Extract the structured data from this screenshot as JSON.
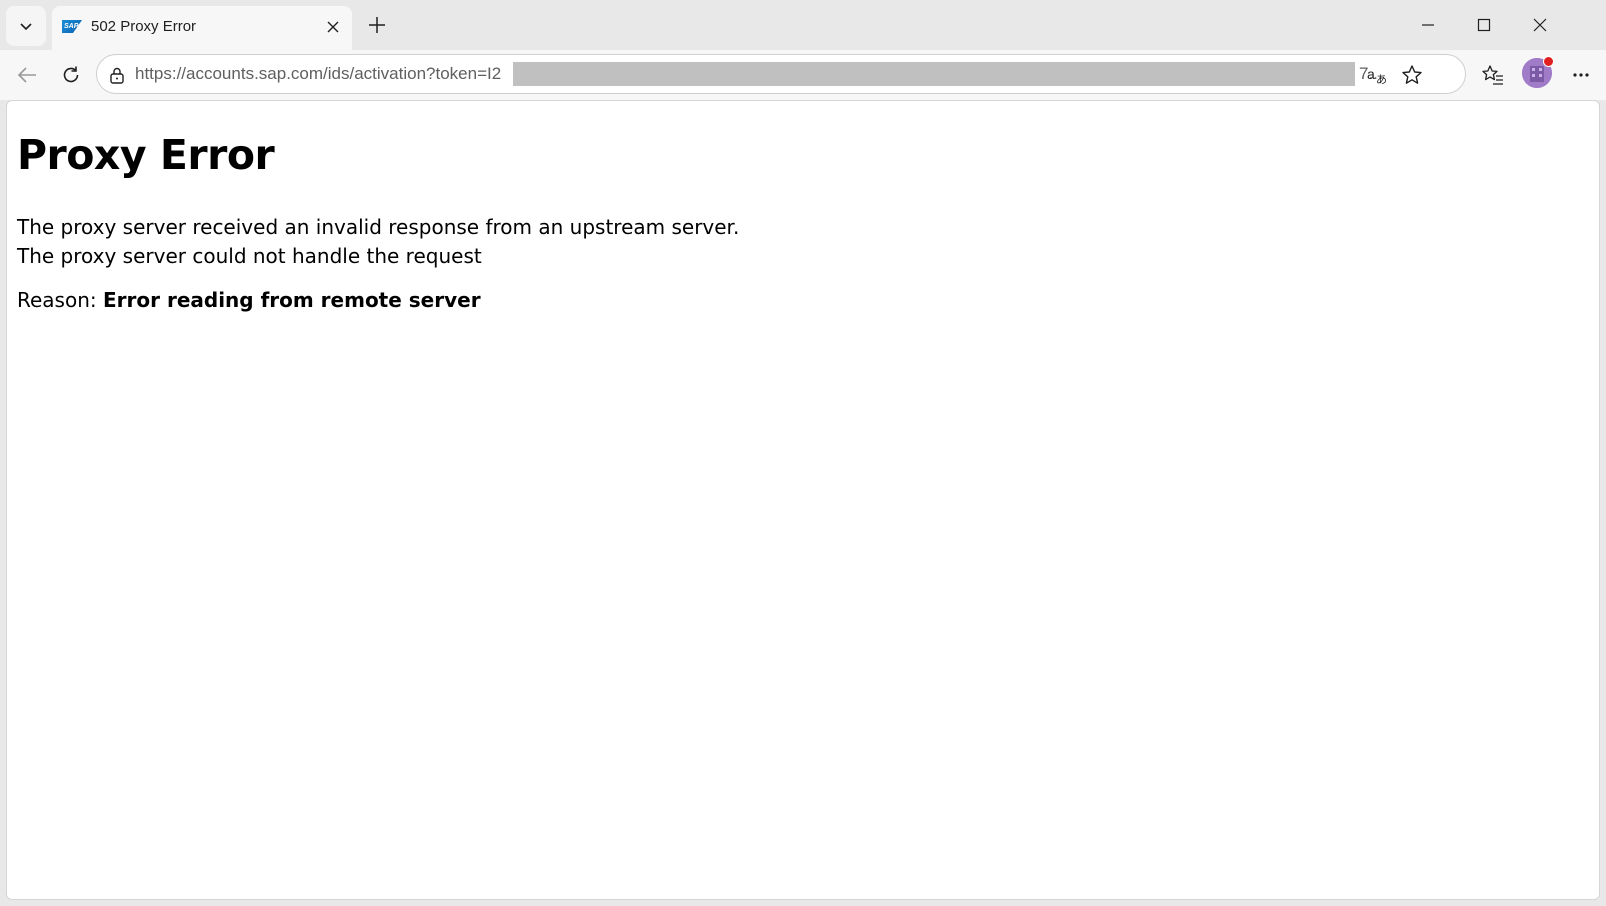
{
  "browser": {
    "tab": {
      "title": "502 Proxy Error",
      "favicon_text": "SAP"
    },
    "address": {
      "url_host": "https://accounts.sap.com",
      "url_path": "/ids/activation?token=I2",
      "url_tail": "7..."
    }
  },
  "page": {
    "heading": "Proxy Error",
    "line1": "The proxy server received an invalid response from an upstream server.",
    "line2": "The proxy server could not handle the request",
    "reason_label": "Reason: ",
    "reason_value": "Error reading from remote server"
  },
  "colors": {
    "chrome_bg": "#e8e8e8",
    "toolbar_bg": "#f7f7f7",
    "avatar": "#a07bc8",
    "notification_dot": "#e02020"
  }
}
